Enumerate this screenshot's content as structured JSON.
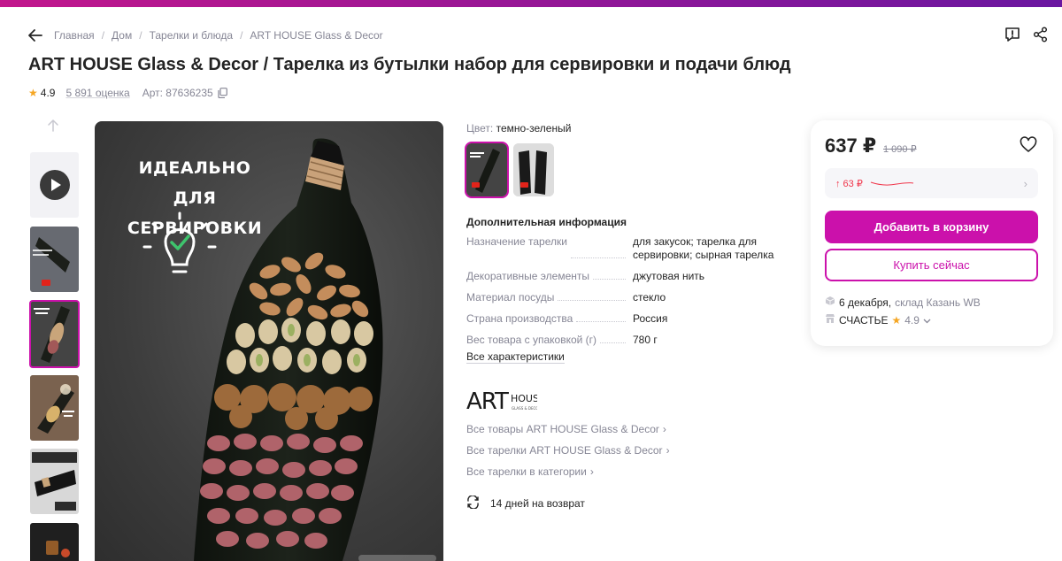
{
  "breadcrumbs": [
    "Главная",
    "Дом",
    "Тарелки и блюда",
    "ART HOUSE Glass & Decor"
  ],
  "title": "ART HOUSE Glass & Decor / Тарелка из бутылки набор для сервировки и подачи блюд",
  "rating": "4.9",
  "reviews": "5 891 оценка",
  "article": "Арт: 87636235",
  "image_promo_text": "ИДЕАЛЬНО ДЛЯ СЕРВИРОВКИ",
  "color": {
    "label": "Цвет:",
    "value": "темно-зеленый"
  },
  "additional_info_title": "Дополнительная информация",
  "specs": [
    {
      "key": "Назначение тарелки",
      "value": "для закусок; тарелка для сервировки; сырная тарелка"
    },
    {
      "key": "Декоративные элементы",
      "value": "джутовая нить"
    },
    {
      "key": "Материал посуды",
      "value": "стекло"
    },
    {
      "key": "Страна производства",
      "value": "Россия"
    },
    {
      "key": "Вес товара с упаковкой (г)",
      "value": "780 г"
    }
  ],
  "all_characteristics": "Все характеристики",
  "brand": {
    "logo_text": "ART HOUSE",
    "logo_subtext": "GLASS & DECOR",
    "links": [
      "Все товары ART HOUSE Glass & Decor",
      "Все тарелки ART HOUSE Glass & Decor",
      "Все тарелки в категории"
    ]
  },
  "returns": "14 дней на возврат",
  "card": {
    "price": "637 ₽",
    "old_price": "1 090 ₽",
    "promo": "↑ 63 ₽",
    "add_to_cart": "Добавить в корзину",
    "buy_now": "Купить сейчас",
    "delivery_date": "6 декабря,",
    "warehouse": "склад Казань WB",
    "seller": "СЧАСТЬЕ",
    "seller_rating": "4.9"
  },
  "colors": {
    "accent": "#cb11ab",
    "price_up": "#f0364b",
    "star": "#f5a623"
  }
}
